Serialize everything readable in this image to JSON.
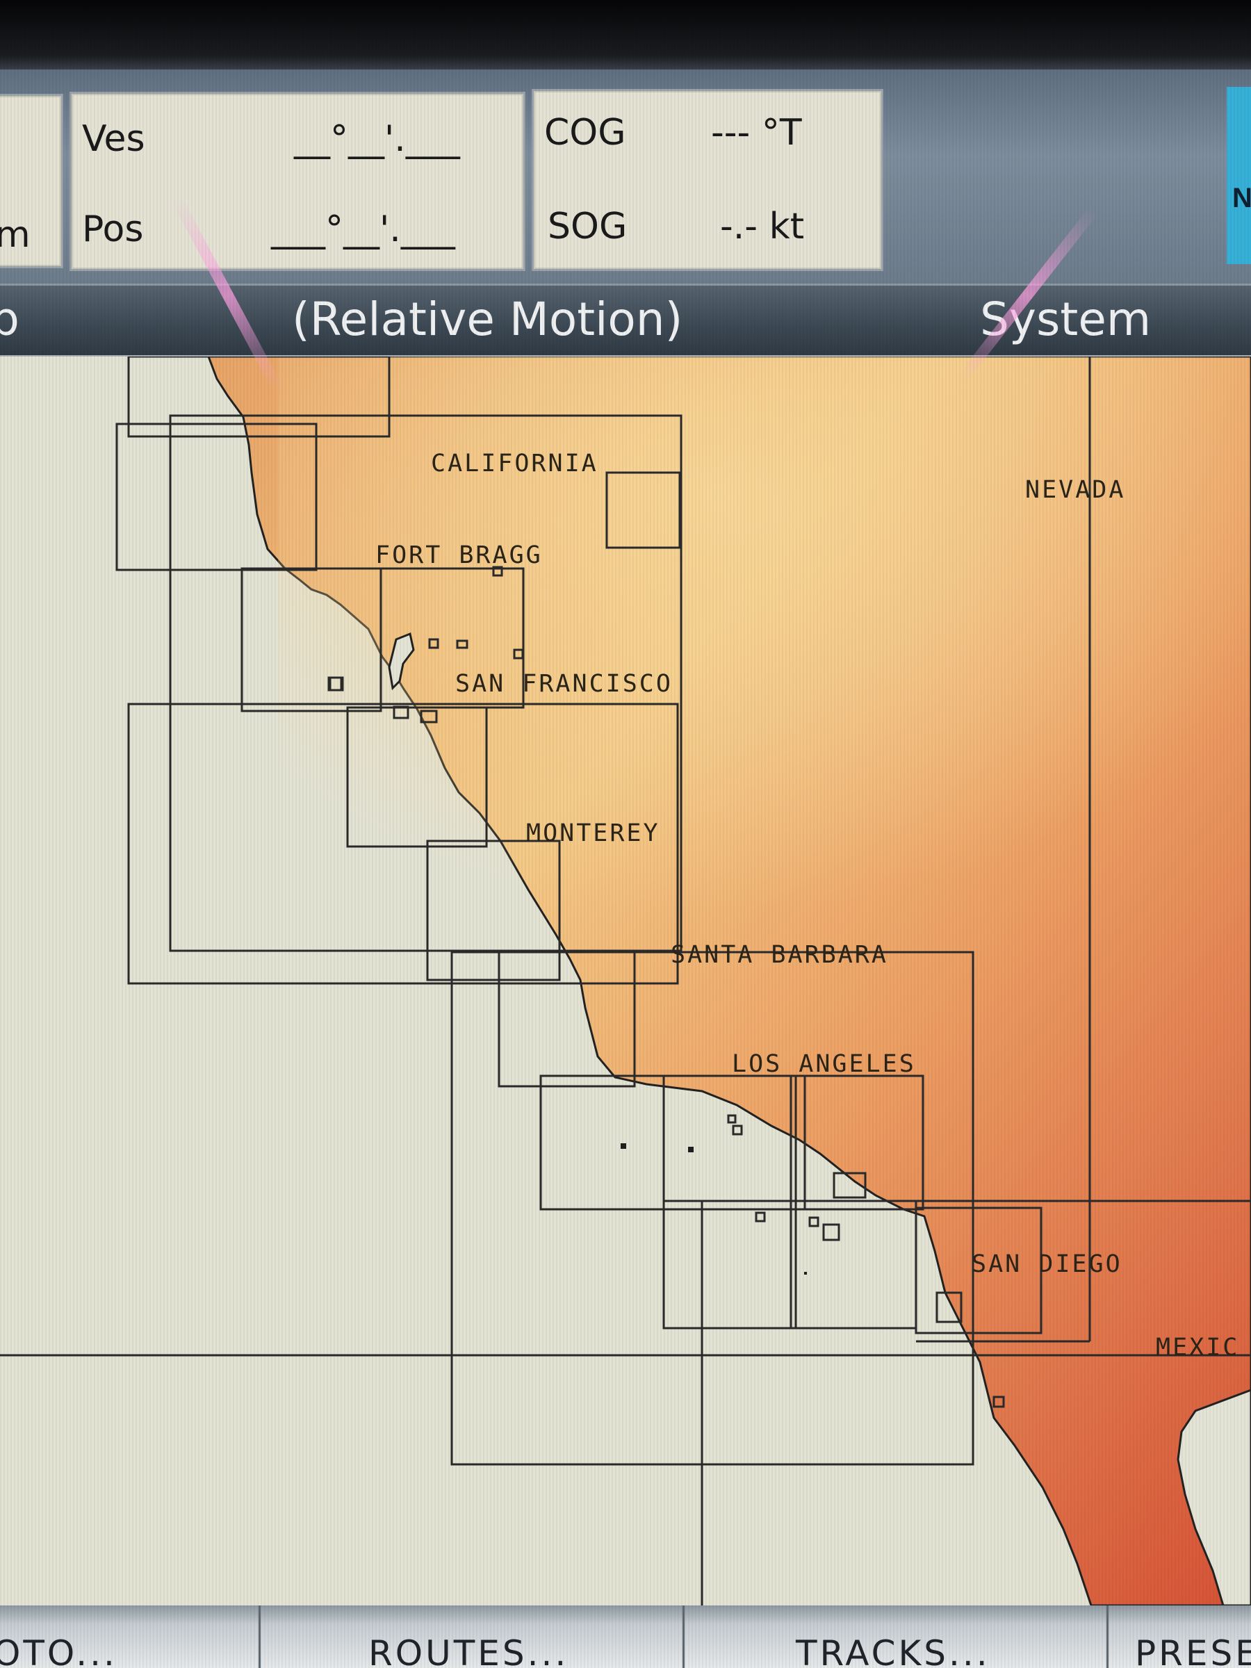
{
  "databar": {
    "left_partial": "m",
    "vessel": {
      "ves_label": "Ves",
      "ves_value": "__°__'.___",
      "pos_label": "Pos",
      "pos_value": "___°__'.___"
    },
    "course": {
      "cog_label": "COG",
      "cog_value": "--- °T",
      "sog_label": "SOG",
      "sog_value": "-.- kt"
    },
    "accent_tile_partial": "N"
  },
  "titlebar": {
    "left_partial": "p",
    "mode": "(Relative Motion)",
    "right": "System"
  },
  "map": {
    "labels": {
      "california": "CALIFORNIA",
      "nevada": "NEVADA",
      "fort_bragg": "FORT BRAGG",
      "san_francisco": "SAN FRANCISCO",
      "monterey": "MONTEREY",
      "santa_barbara": "SANTA BARBARA",
      "los_angeles": "LOS ANGELES",
      "san_diego": "SAN DIEGO",
      "mexico": "MEXIC"
    },
    "colors": {
      "sea": "#e4e4d6",
      "land_light": "#f2c27e",
      "land_mid": "#e69a5c",
      "land_dark": "#d9603c",
      "chart_outline": "#2a2a2a"
    }
  },
  "softkeys": {
    "goto": "OTO...",
    "routes": "ROUTES...",
    "tracks": "TRACKS...",
    "presets": "PRESE"
  }
}
